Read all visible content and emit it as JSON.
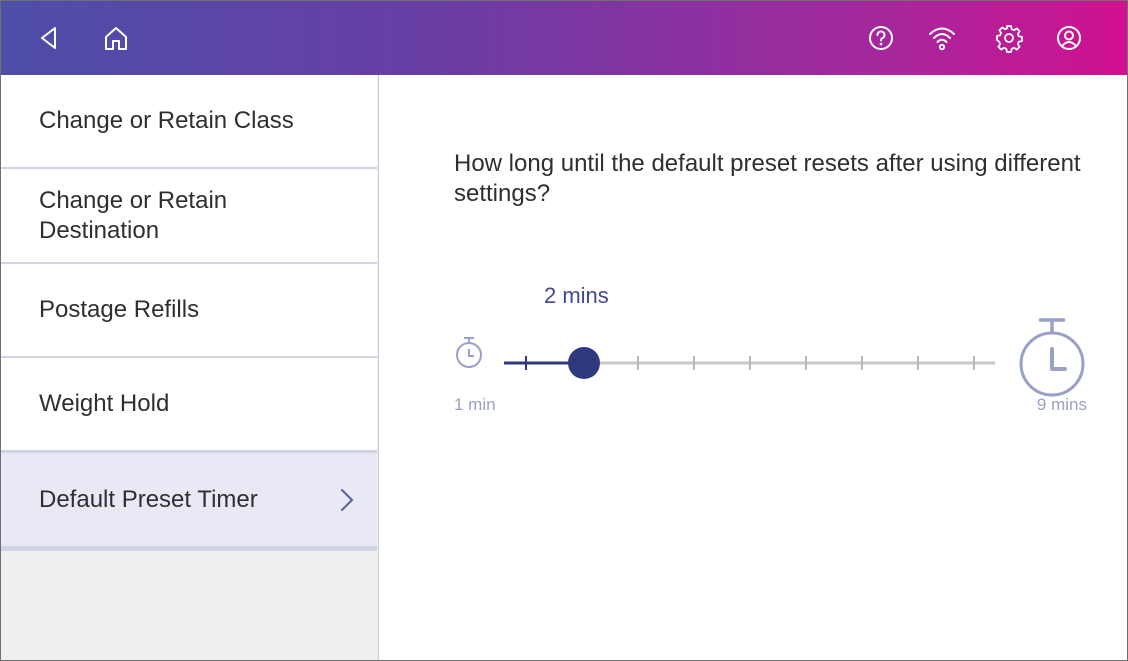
{
  "topbar": {
    "icons": [
      "back-icon",
      "home-icon",
      "help-icon",
      "wifi-icon",
      "settings-icon",
      "account-icon"
    ],
    "gradient_start": "#4d4ea8",
    "gradient_end": "#d1108f"
  },
  "sidebar": {
    "items": [
      {
        "label": "Change or Retain Class"
      },
      {
        "label": "Change or Retain Destination"
      },
      {
        "label": "Postage Refills"
      },
      {
        "label": "Weight Hold"
      },
      {
        "label": "Default Preset Timer",
        "active": true
      }
    ]
  },
  "main": {
    "question": "How long until the default preset resets after using different settings?",
    "slider": {
      "current_label": "2 mins",
      "min_label": "1 min",
      "max_label": "9 mins",
      "min": 1,
      "max": 9,
      "value": 2,
      "accent": "#2f3a7e",
      "track_color": "#c8c8c8",
      "min_icon": "stopwatch-small-icon",
      "max_icon": "stopwatch-large-icon"
    }
  }
}
